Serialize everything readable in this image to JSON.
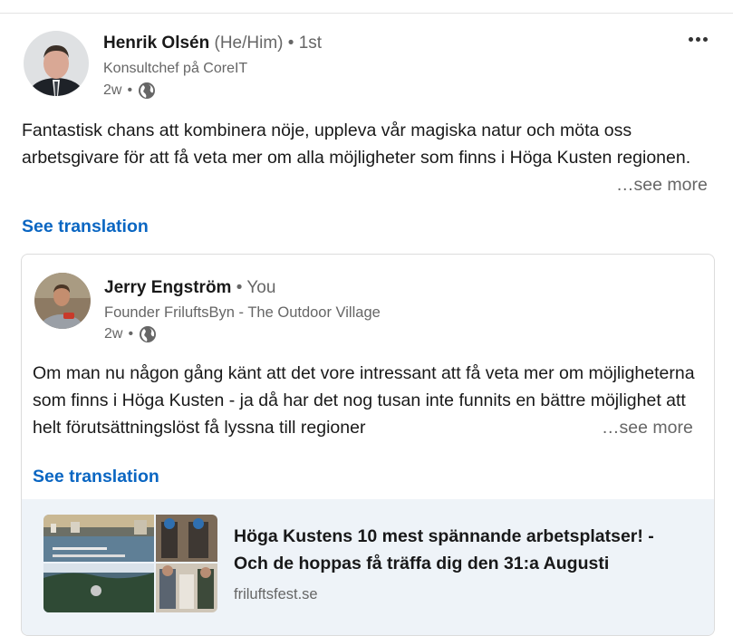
{
  "post": {
    "author": {
      "name": "Henrik Olsén",
      "pronouns": "(He/Him)",
      "degree": "1st",
      "headline": "Konsultchef på CoreIT",
      "time": "2w"
    },
    "text": "Fantastisk chans att kombinera nöje, uppleva vår magiska natur och möta oss arbetsgivare för att få veta mer om alla möjligheter som finns i Höga Kusten regionen.",
    "see_more": "…see more",
    "see_translation": "See translation",
    "menu_icon": "more-horizontal-icon"
  },
  "reshared": {
    "author": {
      "name": "Jerry Engström",
      "relation": "You",
      "headline": "Founder FriluftsByn - The Outdoor Village",
      "time": "2w"
    },
    "text": "Om man nu någon gång känt att det vore intressant att få veta mer om möjligheterna som finns i Höga Kusten - ja då har det nog tusan inte funnits en bättre möjlighet att helt förutsättningslöst få lyssna till regioner",
    "see_more": "…see more",
    "see_translation": "See translation",
    "link": {
      "title": "Höga Kustens 10 mest spännande arbetsplatser! - Och de hoppas få träffa dig den 31:a Augusti",
      "domain": "friluftsfest.se"
    }
  },
  "colors": {
    "link_blue": "#0a66c2",
    "muted": "#666666",
    "preview_bg": "#eef3f8"
  }
}
